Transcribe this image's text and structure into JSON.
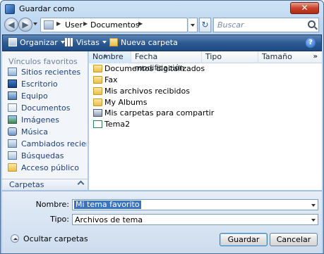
{
  "window": {
    "title": "Guardar como",
    "close_label": "✕"
  },
  "address": {
    "crumbs": [
      "User",
      "Documentos"
    ]
  },
  "search": {
    "placeholder": "Buscar"
  },
  "toolbar": {
    "organize": "Organizar",
    "views": "Vistas",
    "new_folder": "Nueva carpeta"
  },
  "sidebar": {
    "heading": "Vínculos favoritos",
    "items": [
      {
        "label": "Sitios recientes",
        "icon": "recent-places-icon"
      },
      {
        "label": "Escritorio",
        "icon": "desktop-icon"
      },
      {
        "label": "Equipo",
        "icon": "computer-icon"
      },
      {
        "label": "Documentos",
        "icon": "documents-icon"
      },
      {
        "label": "Imágenes",
        "icon": "pictures-icon"
      },
      {
        "label": "Música",
        "icon": "music-icon"
      },
      {
        "label": "Cambiados reciente...",
        "icon": "recently-changed-icon"
      },
      {
        "label": "Búsquedas",
        "icon": "searches-icon"
      },
      {
        "label": "Acceso público",
        "icon": "public-folder-icon"
      }
    ],
    "folders_label": "Carpetas"
  },
  "columns": [
    "Nombre",
    "Fecha modificación",
    "Tipo",
    "Tamaño"
  ],
  "files": [
    {
      "name": "Documentos digitalizados",
      "kind": "folder"
    },
    {
      "name": "Fax",
      "kind": "folder"
    },
    {
      "name": "Mis archivos recibidos",
      "kind": "folder"
    },
    {
      "name": "My Albums",
      "kind": "folder"
    },
    {
      "name": "Mis carpetas para compartir",
      "kind": "shared-folder"
    },
    {
      "name": "Tema2",
      "kind": "theme-file"
    }
  ],
  "form": {
    "filename_label": "Nombre:",
    "filename_value": "Mi tema favorito",
    "type_label": "Tipo:",
    "type_value": "Archivos de tema"
  },
  "footer": {
    "hide_folders": "Ocultar carpetas",
    "save": "Guardar",
    "cancel": "Cancelar"
  },
  "colors": {
    "toolbar": "#2c5a92",
    "link": "#1e3f7a",
    "selection": "#3a75c4"
  }
}
